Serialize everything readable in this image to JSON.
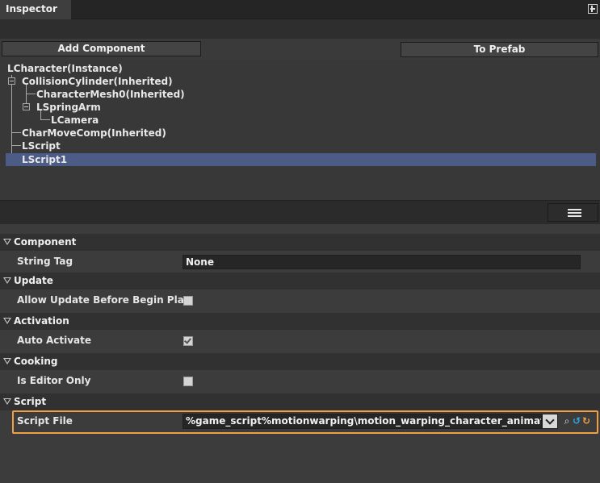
{
  "window": {
    "tab_title": "Inspector"
  },
  "toolbar": {
    "add_component": "Add Component",
    "to_prefab": "To Prefab"
  },
  "tree": {
    "root": "LCharacter(Instance)",
    "items": [
      {
        "label": "CollisionCylinder(Inherited)"
      },
      {
        "label": "CharacterMesh0(Inherited)"
      },
      {
        "label": "LSpringArm"
      },
      {
        "label": "LCamera"
      },
      {
        "label": "CharMoveComp(Inherited)"
      },
      {
        "label": "LScript"
      },
      {
        "label": "LScript1"
      }
    ],
    "selected": "LScript1"
  },
  "sections": {
    "component": {
      "title": "Component",
      "string_tag_label": "String Tag",
      "string_tag_value": "None"
    },
    "update": {
      "title": "Update",
      "allow_update_label": "Allow Update Before Begin Play",
      "allow_update_checked": false
    },
    "activation": {
      "title": "Activation",
      "auto_activate_label": "Auto Activate",
      "auto_activate_checked": true
    },
    "cooking": {
      "title": "Cooking",
      "is_editor_only_label": "Is Editor Only",
      "is_editor_only_checked": false
    },
    "script": {
      "title": "Script",
      "script_file_label": "Script File",
      "script_file_value": "%game_script%motionwarping\\motion_warping_character_animation.lua"
    }
  },
  "icons": {
    "pin": "pin-icon",
    "list": "list-view-icon",
    "search": "search-icon",
    "open": "open-file-icon",
    "revert": "revert-icon"
  },
  "colors": {
    "selection": "#4d5c86",
    "highlight_border": "#f0a044",
    "accent_blue": "#2fa8e8"
  }
}
